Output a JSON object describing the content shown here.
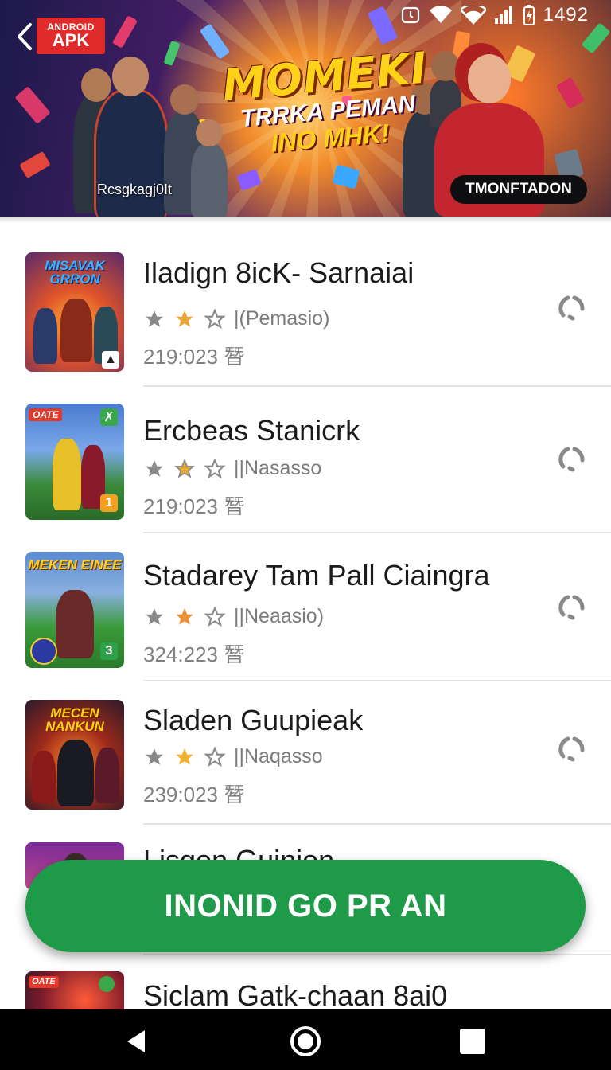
{
  "status_bar": {
    "time": "1492"
  },
  "banner": {
    "badge_small": "ANDROID",
    "badge_big": "APK",
    "title_line1": "MOMEKI",
    "title_line2": "TRRKA PEMAN",
    "title_line3": "INO MHK!",
    "caption": "Rcsgkagj0It",
    "cta_label": "TMONFTADON"
  },
  "apps": [
    {
      "name": "Iladign 8icK- Sarnaiai",
      "publisher": "|(Pemasio)",
      "meta": "219:023 朁",
      "thumb_text": "MISAVAK GRRON",
      "thumb_badge": ""
    },
    {
      "name": "Ercbeas Stanicrk",
      "publisher": "||Nasasso",
      "meta": "219:023 朁",
      "thumb_text": "OATE",
      "thumb_badge": "1"
    },
    {
      "name": "Stadarey Tam Pall Ciaingra",
      "publisher": "||Neaasio)",
      "meta": "324:223 朁",
      "thumb_text": "MEKEN EINEE",
      "thumb_badge": "3"
    },
    {
      "name": "Sladen Guupieak",
      "publisher": "||Naqasso",
      "meta": "239:023 朁",
      "thumb_text": "MECEN NANKUN",
      "thumb_badge": ""
    },
    {
      "name": "Lisgon Guinion",
      "publisher": "",
      "meta": "",
      "thumb_text": "",
      "thumb_badge": ""
    },
    {
      "name": "Siclam Gatk-chaan 8ai0",
      "publisher": "",
      "meta": "",
      "thumb_text": "OATE",
      "thumb_badge": ""
    }
  ],
  "primary_button": {
    "label": "INONID GO PR AN"
  },
  "icons": {
    "back": "back-arrow-icon",
    "download": "download-progress-icon",
    "star": "star-icon",
    "nav_back": "nav-back-icon",
    "nav_home": "nav-home-icon",
    "nav_recents": "nav-recents-icon"
  },
  "colors": {
    "accent_green": "#1f9a49",
    "badge_red": "#e12b2b",
    "star_gold": "#e8a93a",
    "star_grey": "#8a8a8a"
  }
}
